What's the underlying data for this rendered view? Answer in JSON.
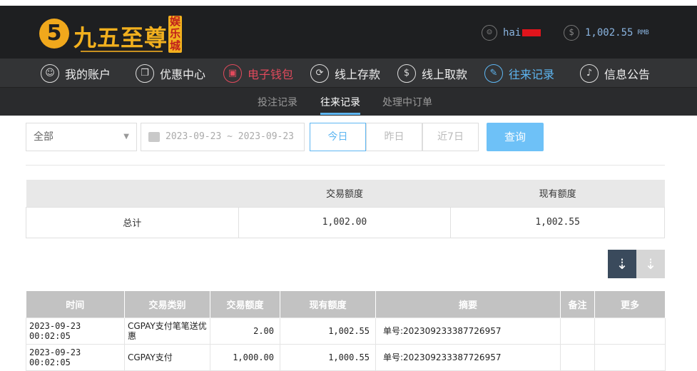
{
  "header": {
    "logo_mark": "5",
    "logo_text": "九五至尊",
    "logo_badge": "娱乐城",
    "user_icon": "user-icon",
    "username": "hai",
    "balance_icon": "dollar-icon",
    "balance": "1,002.55",
    "currency": "RMB"
  },
  "nav": {
    "items": [
      {
        "label": "我的账户",
        "icon": "account-icon",
        "glyph": "☺"
      },
      {
        "label": "优惠中心",
        "icon": "gift-icon",
        "glyph": "❒"
      },
      {
        "label": "电子钱包",
        "icon": "wallet-icon",
        "glyph": "▣"
      },
      {
        "label": "线上存款",
        "icon": "deposit-icon",
        "glyph": "⟳"
      },
      {
        "label": "线上取款",
        "icon": "withdraw-icon",
        "glyph": "$"
      },
      {
        "label": "往来记录",
        "icon": "records-icon",
        "glyph": "✎"
      },
      {
        "label": "信息公告",
        "icon": "bell-icon",
        "glyph": "♪"
      }
    ]
  },
  "subnav": {
    "items": [
      "投注记录",
      "往来记录",
      "处理中订单"
    ],
    "active": "往来记录"
  },
  "filters": {
    "type_select": "全部",
    "date_range": "2023-09-23 ~ 2023-09-23",
    "quick": [
      "今日",
      "昨日",
      "近7日"
    ],
    "query_label": "查询"
  },
  "summary": {
    "headers": [
      "",
      "交易额度",
      "现有额度"
    ],
    "row": [
      "总计",
      "1,002.00",
      "1,002.55"
    ]
  },
  "sort": {
    "desc_icon": "sort-desc-icon",
    "asc_icon": "sort-asc-icon"
  },
  "records": {
    "headers": [
      "时间",
      "交易类别",
      "交易额度",
      "现有额度",
      "摘要",
      "备注",
      "更多"
    ],
    "rows": [
      [
        "2023-09-23 00:02:05",
        "CGPAY支付笔笔送优惠",
        "2.00",
        "1,002.55",
        "单号:20230923338772695​7",
        "",
        ""
      ],
      [
        "2023-09-23 00:02:05",
        "CGPAY支付",
        "1,000.00",
        "1,000.55",
        "单号:202309233387726957",
        "",
        ""
      ]
    ]
  }
}
